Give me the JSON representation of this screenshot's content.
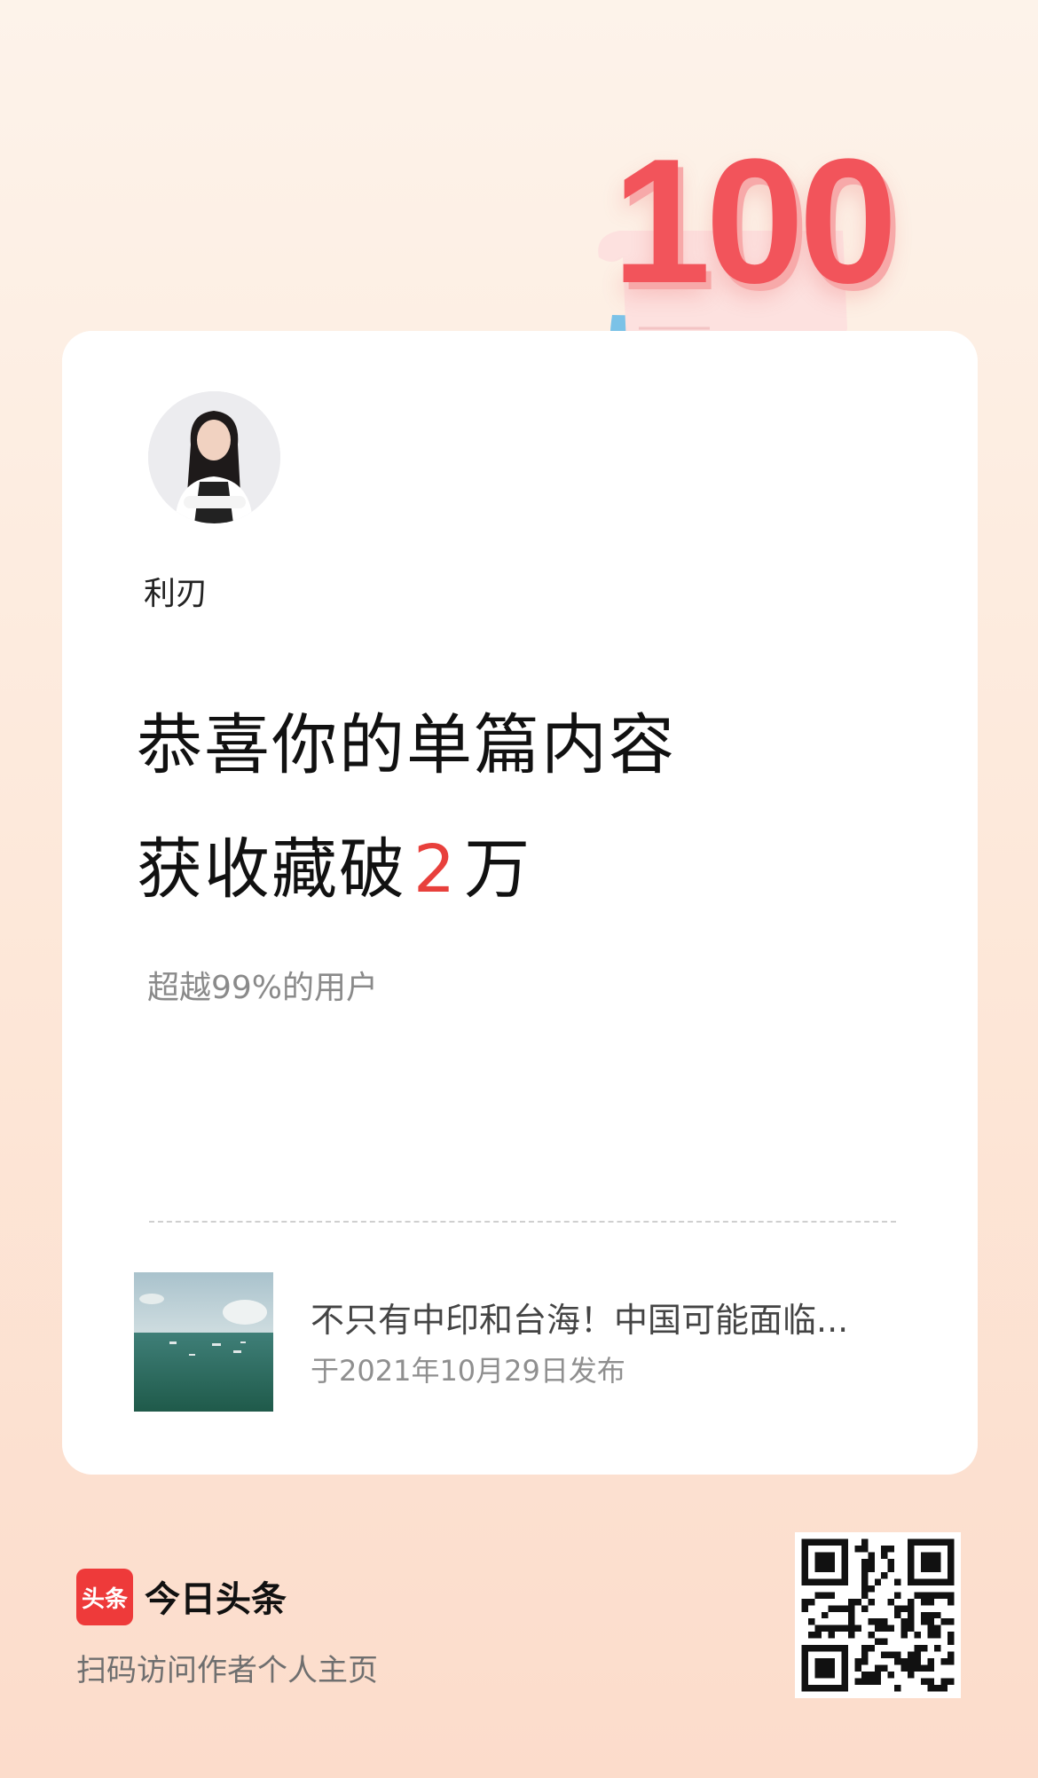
{
  "badge": {
    "number": "100"
  },
  "author": {
    "name": "利刃"
  },
  "headline": {
    "line1": "恭喜你的单篇内容",
    "line2_prefix": "获收藏破",
    "line2_number": "2",
    "line2_suffix": "万"
  },
  "subtitle": "超越99%的用户",
  "article": {
    "title": "不只有中印和台海！中国可能面临...",
    "date": "于2021年10月29日发布"
  },
  "footer": {
    "logo_text": "头条",
    "brand": "今日头条",
    "prompt": "扫码访问作者个人主页"
  },
  "colors": {
    "accent": "#e8403c",
    "logo": "#ee3a3a"
  }
}
